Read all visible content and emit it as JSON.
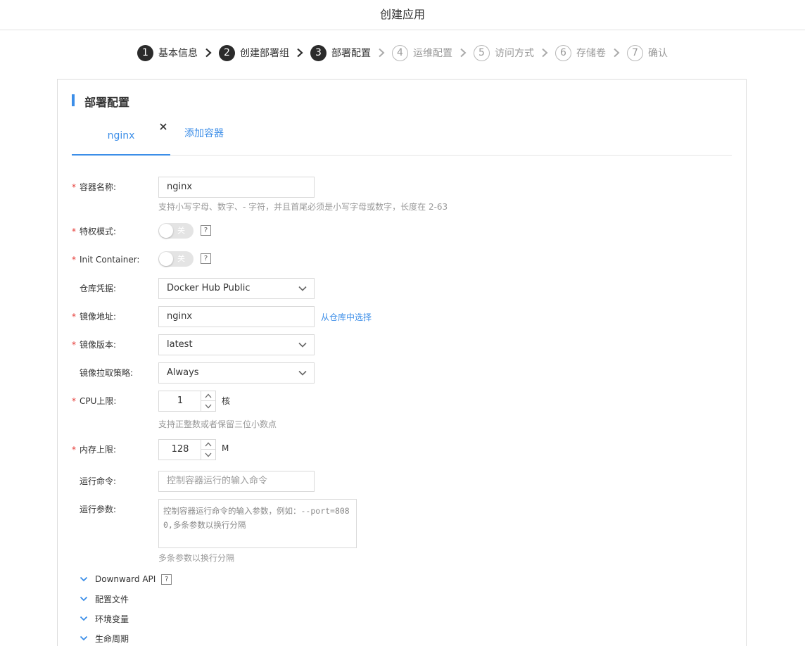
{
  "page": {
    "title": "创建应用"
  },
  "steps": [
    {
      "num": "1",
      "label": "基本信息",
      "state": "done"
    },
    {
      "num": "2",
      "label": "创建部署组",
      "state": "done"
    },
    {
      "num": "3",
      "label": "部署配置",
      "state": "current"
    },
    {
      "num": "4",
      "label": "运维配置",
      "state": "todo"
    },
    {
      "num": "5",
      "label": "访问方式",
      "state": "todo"
    },
    {
      "num": "6",
      "label": "存储卷",
      "state": "todo"
    },
    {
      "num": "7",
      "label": "确认",
      "state": "todo"
    }
  ],
  "section": {
    "title": "部署配置"
  },
  "tabs": {
    "active": "nginx",
    "add": "添加容器",
    "close_icon": "close-icon"
  },
  "form": {
    "container_name": {
      "label": "容器名称:",
      "value": "nginx",
      "hint": "支持小写字母、数字、- 字符，并且首尾必须是小写字母或数字，长度在 2-63"
    },
    "privileged": {
      "label": "特权模式:",
      "state": "关",
      "help": "?"
    },
    "init_container": {
      "label": "Init Container:",
      "state": "关",
      "help": "?"
    },
    "registry": {
      "label": "仓库凭据:",
      "value": "Docker Hub Public"
    },
    "image": {
      "label": "镜像地址:",
      "value": "nginx",
      "link": "从仓库中选择"
    },
    "image_tag": {
      "label": "镜像版本:",
      "value": "latest"
    },
    "pull_policy": {
      "label": "镜像拉取策略:",
      "value": "Always"
    },
    "cpu": {
      "label": "CPU上限:",
      "value": "1",
      "unit": "核",
      "hint": "支持正整数或者保留三位小数点"
    },
    "memory": {
      "label": "内存上限:",
      "value": "128",
      "unit": "M"
    },
    "command": {
      "label": "运行命令:",
      "placeholder": "控制容器运行的输入命令"
    },
    "args": {
      "label": "运行参数:",
      "placeholder": "控制容器运行命令的输入参数，例如：--port=8080,多条参数以换行分隔",
      "hint": "多条参数以换行分隔"
    }
  },
  "collapsibles": [
    {
      "label": "Downward API",
      "help": "?"
    },
    {
      "label": "配置文件"
    },
    {
      "label": "环境变量"
    },
    {
      "label": "生命周期"
    }
  ],
  "colors": {
    "accent": "#3c8ee8",
    "required": "#e53935",
    "step_done": "#2b2b2b"
  }
}
